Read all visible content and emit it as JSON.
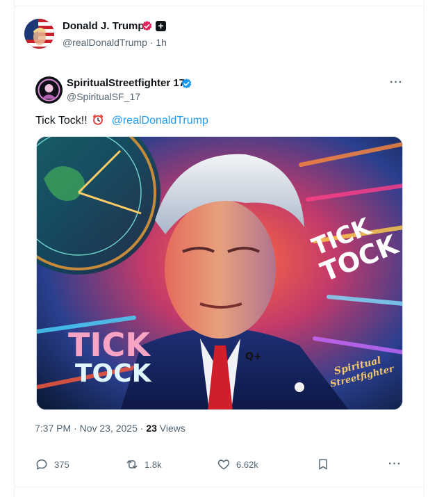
{
  "post": {
    "author_name": "Donald J. Trump",
    "handle": "@realDonaldTrump",
    "separator": " · ",
    "age": "1h",
    "plus_symbol": "+"
  },
  "quote": {
    "author_name": "SpiritualStreetfighter 17",
    "handle": "@SpiritualSF_17",
    "more_label": "···",
    "text": "Tick Tock!!",
    "clock_icon": "alarm-clock-icon",
    "mention": "@realDonaldTrump",
    "image": {
      "headline_left_1": "TICK",
      "headline_left_2": "TOCK",
      "headline_right_1": "TICK",
      "headline_right_2": "TOCK",
      "watermark_1": "Spiritual",
      "watermark_2": "Streetfighter",
      "pin_text": "Q+"
    },
    "timestamp": "7:37 PM · Nov 23, 2025 · ",
    "views_count": "23",
    "views_label": " Views"
  },
  "actions": {
    "replies": "375",
    "reposts": "1.8k",
    "likes": "6.62k",
    "more_label": "···"
  },
  "colors": {
    "accent": "#1d9bf0",
    "pink_badge": "#e0245e",
    "muted": "#536471"
  }
}
